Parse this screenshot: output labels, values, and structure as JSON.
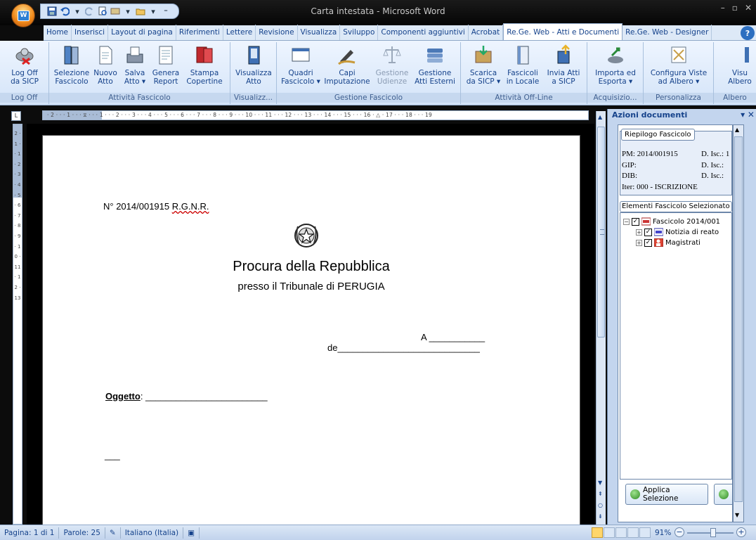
{
  "window": {
    "title": "Carta intestata - Microsoft Word",
    "controls": [
      "–",
      "▫",
      "✕"
    ]
  },
  "tabs": [
    {
      "label": "Home"
    },
    {
      "label": "Inserisci"
    },
    {
      "label": "Layout di pagina"
    },
    {
      "label": "Riferimenti"
    },
    {
      "label": "Lettere"
    },
    {
      "label": "Revisione"
    },
    {
      "label": "Visualizza"
    },
    {
      "label": "Sviluppo"
    },
    {
      "label": "Componenti aggiuntivi"
    },
    {
      "label": "Acrobat"
    },
    {
      "label": "Re.Ge. Web - Atti e Documenti"
    },
    {
      "label": "Re.Ge. Web - Designer"
    }
  ],
  "ribbon": {
    "groups": [
      {
        "label": "Log Off"
      },
      {
        "label": "Attività Fascicolo"
      },
      {
        "label": "Visualizz..."
      },
      {
        "label": "Gestione Fascicolo"
      },
      {
        "label": "Attività Off-Line"
      },
      {
        "label": "Acquisizio..."
      },
      {
        "label": "Personalizza"
      },
      {
        "label": "Albero"
      }
    ],
    "buttons": [
      {
        "l1": "Log Off",
        "l2": "da SICP"
      },
      {
        "l1": "Selezione",
        "l2": "Fascicolo"
      },
      {
        "l1": "Nuovo",
        "l2": "Atto"
      },
      {
        "l1": "Salva",
        "l2": "Atto ▾"
      },
      {
        "l1": "Genera",
        "l2": "Report"
      },
      {
        "l1": "Stampa",
        "l2": "Copertine"
      },
      {
        "l1": "Visualizza",
        "l2": "Atto"
      },
      {
        "l1": "Quadri",
        "l2": "Fascicolo ▾"
      },
      {
        "l1": "Capi",
        "l2": "Imputazione"
      },
      {
        "l1": "Gestione",
        "l2": "Udienze"
      },
      {
        "l1": "Gestione",
        "l2": "Atti Esterni"
      },
      {
        "l1": "Scarica",
        "l2": "da SICP ▾"
      },
      {
        "l1": "Fascicoli",
        "l2": "in Locale"
      },
      {
        "l1": "Invia Atti",
        "l2": "a SICP"
      },
      {
        "l1": "Importa ed",
        "l2": "Esporta ▾"
      },
      {
        "l1": "Configura Viste",
        "l2": "ad Albero ▾"
      },
      {
        "l1": "Visu",
        "l2": "Albero"
      }
    ]
  },
  "rulers": {
    "horizontal": "· 2 · · · 1 · · · ⧖ · · · 1 · · · 2 · · · 3 · · · 4 · · · 5 · · · 6 · · · 7 · · · 8 · · · 9 · · · 10 · · · 11 · · · 12 · · · 13 · · · 14 · · · 15 · · · 16 · △ · 17 · · · 18 · · · 19",
    "vertical": "2 · 1 · · 1 · 2 · 3 · 4 · 5 · 6 · 7 · 8 · 9 · 10 · 11 · 12 · 13"
  },
  "document": {
    "rgnr_prefix": "N° 2014/001915 ",
    "rgnr_suffix": "R.G.N.R.",
    "procura": "Procura della Repubblica",
    "presso": "presso il Tribunale di PERUGIA",
    "a_line": "A ___________",
    "de_line": "de____________________________",
    "oggetto_label": "Oggetto",
    "oggetto_line": ": ________________________",
    "dash": "___"
  },
  "pane": {
    "title": "Azioni documenti",
    "riepilogo_label": "Riepilogo Fascicolo",
    "riepilogo": {
      "pm": "PM: 2014/001915",
      "pm_isc": "D. Isc.: 1",
      "gip": "GIP:",
      "gip_isc": "D. Isc.:",
      "dib": "DIB:",
      "dib_isc": "D. Isc.:",
      "iter": "Iter: 000 - ISCRIZIONE"
    },
    "elementi_label": "Elementi Fascicolo Selezionato",
    "tree": {
      "root": "Fascicolo 2014/001",
      "child1": "Notizia di reato",
      "child2": "Magistrati"
    },
    "applica_label": "Applica Selezione"
  },
  "status": {
    "pagina": "Pagina: 1 di 1",
    "parole": "Parole: 25",
    "lingua": "Italiano (Italia)",
    "zoom": "91%"
  },
  "colors": {
    "accent": "#15428b",
    "ribbon_bg": "#d4e4f8",
    "office_orb": "#f08a1c"
  }
}
